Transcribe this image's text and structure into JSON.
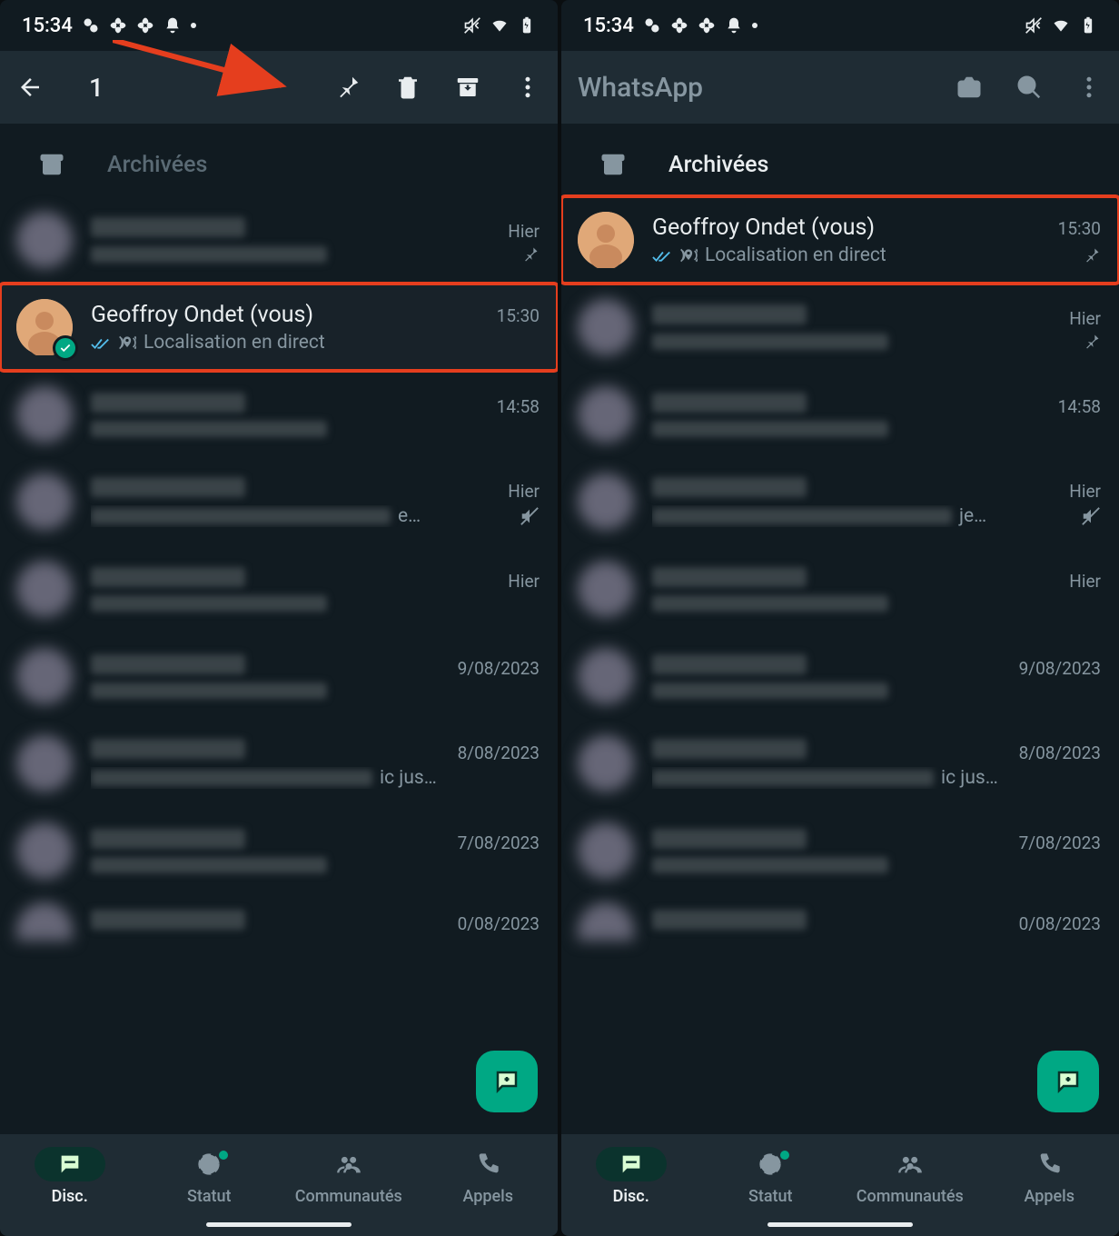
{
  "status": {
    "time": "15:34"
  },
  "left": {
    "selection_count": "1",
    "archived_label": "Archivées",
    "highlight_chat": {
      "name": "Geoffroy Ondet (vous)",
      "subtitle": "Localisation en direct",
      "time": "15:30"
    },
    "rows": [
      {
        "time": "Hier",
        "pinned": true
      },
      {
        "time": "14:58"
      },
      {
        "time": "Hier",
        "sub_suffix": "e…",
        "muted": true
      },
      {
        "time": "Hier"
      },
      {
        "time": "9/08/2023"
      },
      {
        "time": "8/08/2023",
        "sub_suffix": "ic jus…"
      },
      {
        "time": "7/08/2023"
      },
      {
        "time": "0/08/2023"
      }
    ]
  },
  "right": {
    "title": "WhatsApp",
    "archived_label": "Archivées",
    "highlight_chat": {
      "name": "Geoffroy Ondet (vous)",
      "subtitle": "Localisation en direct",
      "time": "15:30"
    },
    "rows": [
      {
        "time": "Hier",
        "pinned": true
      },
      {
        "time": "14:58"
      },
      {
        "time": "Hier",
        "sub_suffix": "je…",
        "muted": true
      },
      {
        "time": "Hier"
      },
      {
        "time": "9/08/2023"
      },
      {
        "time": "8/08/2023",
        "sub_suffix": "ic jus…"
      },
      {
        "time": "7/08/2023"
      },
      {
        "time": "0/08/2023"
      }
    ]
  },
  "nav": {
    "disc": "Disc.",
    "statut": "Statut",
    "communautes": "Communautés",
    "appels": "Appels"
  }
}
